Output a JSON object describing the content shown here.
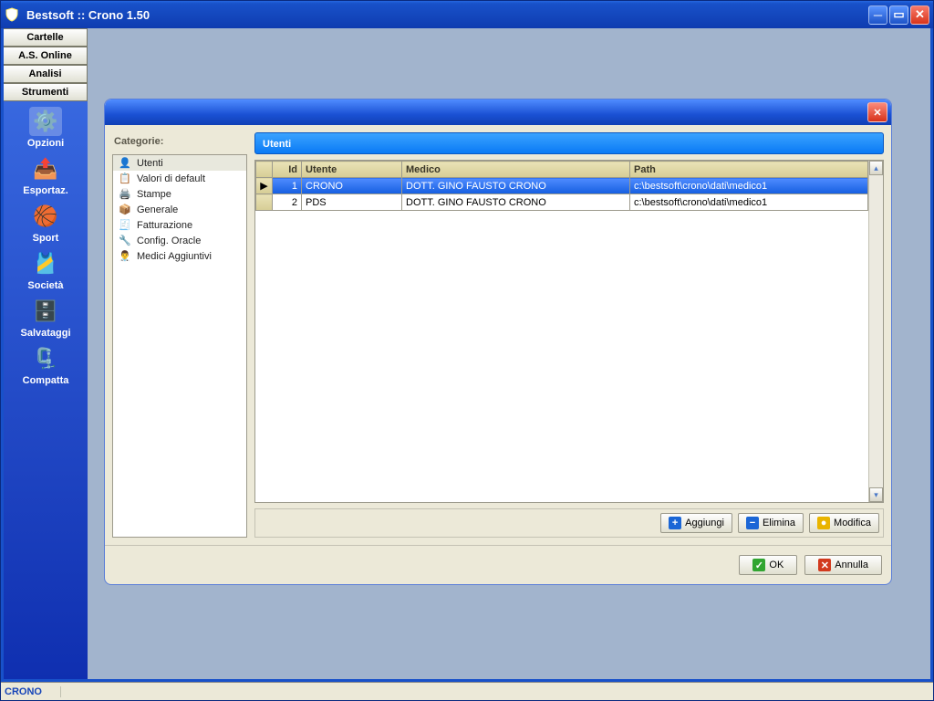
{
  "window": {
    "title": "Bestsoft :: Crono 1.50"
  },
  "sidebar": {
    "tabs": [
      "Cartelle",
      "A.S. Online",
      "Analisi",
      "Strumenti"
    ],
    "tools": [
      {
        "label": "Opzioni",
        "icon": "⚙️"
      },
      {
        "label": "Esportaz.",
        "icon": "📤"
      },
      {
        "label": "Sport",
        "icon": "🏀"
      },
      {
        "label": "Società",
        "icon": "🎽"
      },
      {
        "label": "Salvataggi",
        "icon": "🗄️"
      },
      {
        "label": "Compatta",
        "icon": "🗜️"
      }
    ]
  },
  "dialog": {
    "categories_title": "Categorie:",
    "categories": [
      {
        "label": "Utenti",
        "icon": "👤"
      },
      {
        "label": "Valori di default",
        "icon": "📋"
      },
      {
        "label": "Stampe",
        "icon": "🖨️"
      },
      {
        "label": "Generale",
        "icon": "📦"
      },
      {
        "label": "Fatturazione",
        "icon": "🧾"
      },
      {
        "label": "Config. Oracle",
        "icon": "🔧"
      },
      {
        "label": "Medici Aggiuntivi",
        "icon": "👨‍⚕️"
      }
    ],
    "panel_title": "Utenti",
    "columns": {
      "id": "Id",
      "utente": "Utente",
      "medico": "Medico",
      "path": "Path"
    },
    "rows": [
      {
        "id": "1",
        "utente": "CRONO",
        "medico": "DOTT. GINO FAUSTO CRONO",
        "path": "c:\\bestsoft\\crono\\dati\\medico1"
      },
      {
        "id": "2",
        "utente": "PDS",
        "medico": "DOTT. GINO FAUSTO CRONO",
        "path": "c:\\bestsoft\\crono\\dati\\medico1"
      }
    ],
    "selected_row": 0,
    "actions": {
      "add": "Aggiungi",
      "del": "Elimina",
      "mod": "Modifica"
    },
    "footer": {
      "ok": "OK",
      "cancel": "Annulla"
    }
  },
  "status": {
    "user": "CRONO"
  }
}
